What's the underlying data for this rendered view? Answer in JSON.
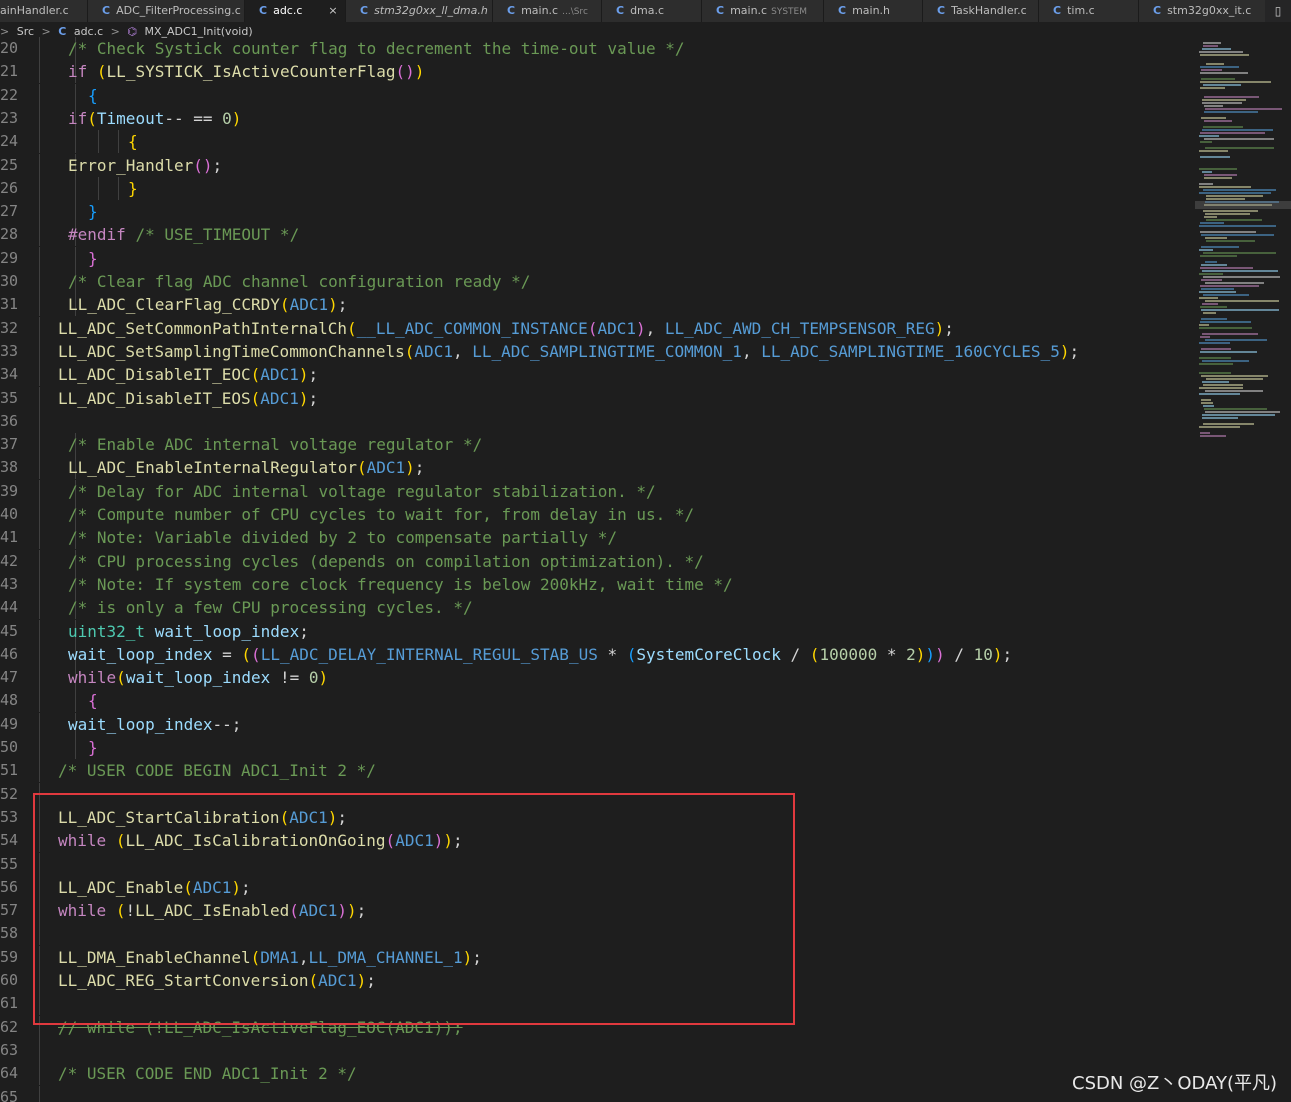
{
  "tabs": [
    {
      "label": "ainHandler.c",
      "italic": false,
      "hint": "",
      "active": false,
      "icon": false
    },
    {
      "label": "ADC_FilterProcessing.c",
      "italic": false,
      "hint": "",
      "active": false,
      "icon": true
    },
    {
      "label": "adc.c",
      "italic": false,
      "hint": "",
      "active": true,
      "icon": true,
      "close": "×"
    },
    {
      "label": "stm32g0xx_ll_dma.h",
      "italic": true,
      "hint": "",
      "active": false,
      "icon": true
    },
    {
      "label": "main.c",
      "italic": false,
      "hint": "...\\Src",
      "active": false,
      "icon": true
    },
    {
      "label": "dma.c",
      "italic": false,
      "hint": "",
      "active": false,
      "icon": true
    },
    {
      "label": "main.c",
      "italic": false,
      "hint": "SYSTEM",
      "active": false,
      "icon": true
    },
    {
      "label": "main.h",
      "italic": false,
      "hint": "",
      "active": false,
      "icon": true
    },
    {
      "label": "TaskHandler.c",
      "italic": false,
      "hint": "",
      "active": false,
      "icon": true
    },
    {
      "label": "tim.c",
      "italic": false,
      "hint": "",
      "active": false,
      "icon": true
    },
    {
      "label": "stm32g0xx_it.c",
      "italic": false,
      "hint": "",
      "active": false,
      "icon": true
    }
  ],
  "tab_icon_glyph": "C",
  "split_icon": "▯",
  "breadcrumb": {
    "sep": ">",
    "folder": "Src",
    "file_icon": "C",
    "file": "adc.c",
    "fn_icon": "⌬",
    "function": "MX_ADC1_Init(void)"
  },
  "lines": [
    {
      "n": "20",
      "indent": 1,
      "tokens": [
        [
          "cm",
          "/* Check Systick counter flag to decrement the time-out value */"
        ]
      ]
    },
    {
      "n": "21",
      "indent": 1,
      "tokens": [
        [
          "kw",
          "if"
        ],
        [
          "pun",
          " "
        ],
        [
          "b1",
          "("
        ],
        [
          "fn",
          "LL_SYSTICK_IsActiveCounterFlag"
        ],
        [
          "b2",
          "()"
        ],
        [
          "b1",
          ")"
        ]
      ]
    },
    {
      "n": "22",
      "indent": 2,
      "tokens": [
        [
          "b3",
          "{"
        ]
      ]
    },
    {
      "n": "23",
      "indent": 1,
      "tokens": [
        [
          "kw",
          "if"
        ],
        [
          "b1",
          "("
        ],
        [
          "var",
          "Timeout"
        ],
        [
          "pun",
          "-- == "
        ],
        [
          "num",
          "0"
        ],
        [
          "b1",
          ")"
        ]
      ]
    },
    {
      "n": "24",
      "indent": 4,
      "tokens": [
        [
          "b1",
          "{"
        ]
      ]
    },
    {
      "n": "25",
      "indent": 1,
      "tokens": [
        [
          "fn",
          "Error_Handler"
        ],
        [
          "b2",
          "()"
        ],
        [
          "pun",
          ";"
        ]
      ]
    },
    {
      "n": "26",
      "indent": 4,
      "tokens": [
        [
          "b1",
          "}"
        ]
      ]
    },
    {
      "n": "27",
      "indent": 2,
      "tokens": [
        [
          "b3",
          "}"
        ]
      ]
    },
    {
      "n": "28",
      "indent": 1,
      "tokens": [
        [
          "pp",
          "#endif"
        ],
        [
          "pun",
          " "
        ],
        [
          "cm",
          "/* USE_TIMEOUT */"
        ]
      ]
    },
    {
      "n": "29",
      "indent": 2,
      "tokens": [
        [
          "b2",
          "}"
        ]
      ]
    },
    {
      "n": "30",
      "indent": 1,
      "tokens": [
        [
          "cm",
          "/* Clear flag ADC channel configuration ready */"
        ]
      ]
    },
    {
      "n": "31",
      "indent": 1,
      "tokens": [
        [
          "fn",
          "LL_ADC_ClearFlag_CCRDY"
        ],
        [
          "b1",
          "("
        ],
        [
          "mac",
          "ADC1"
        ],
        [
          "b1",
          ")"
        ],
        [
          "pun",
          ";"
        ]
      ]
    },
    {
      "n": "32",
      "indent": 0,
      "tokens": [
        [
          "fn",
          "LL_ADC_SetCommonPathInternalCh"
        ],
        [
          "b1",
          "("
        ],
        [
          "mac",
          "__LL_ADC_COMMON_INSTANCE"
        ],
        [
          "b2",
          "("
        ],
        [
          "mac",
          "ADC1"
        ],
        [
          "b2",
          ")"
        ],
        [
          "pun",
          ", "
        ],
        [
          "mac",
          "LL_ADC_AWD_CH_TEMPSENSOR_REG"
        ],
        [
          "b1",
          ")"
        ],
        [
          "pun",
          ";"
        ]
      ]
    },
    {
      "n": "33",
      "indent": 0,
      "tokens": [
        [
          "fn",
          "LL_ADC_SetSamplingTimeCommonChannels"
        ],
        [
          "b1",
          "("
        ],
        [
          "mac",
          "ADC1"
        ],
        [
          "pun",
          ", "
        ],
        [
          "mac",
          "LL_ADC_SAMPLINGTIME_COMMON_1"
        ],
        [
          "pun",
          ", "
        ],
        [
          "mac",
          "LL_ADC_SAMPLINGTIME_160CYCLES_5"
        ],
        [
          "b1",
          ")"
        ],
        [
          "pun",
          ";"
        ]
      ]
    },
    {
      "n": "34",
      "indent": 0,
      "tokens": [
        [
          "fn",
          "LL_ADC_DisableIT_EOC"
        ],
        [
          "b1",
          "("
        ],
        [
          "mac",
          "ADC1"
        ],
        [
          "b1",
          ")"
        ],
        [
          "pun",
          ";"
        ]
      ]
    },
    {
      "n": "35",
      "indent": 0,
      "tokens": [
        [
          "fn",
          "LL_ADC_DisableIT_EOS"
        ],
        [
          "b1",
          "("
        ],
        [
          "mac",
          "ADC1"
        ],
        [
          "b1",
          ")"
        ],
        [
          "pun",
          ";"
        ]
      ]
    },
    {
      "n": "36",
      "indent": 0,
      "tokens": []
    },
    {
      "n": "37",
      "indent": 1,
      "tokens": [
        [
          "cm",
          "/* Enable ADC internal voltage regulator */"
        ]
      ]
    },
    {
      "n": "38",
      "indent": 1,
      "tokens": [
        [
          "fn",
          "LL_ADC_EnableInternalRegulator"
        ],
        [
          "b1",
          "("
        ],
        [
          "mac",
          "ADC1"
        ],
        [
          "b1",
          ")"
        ],
        [
          "pun",
          ";"
        ]
      ]
    },
    {
      "n": "39",
      "indent": 1,
      "tokens": [
        [
          "cm",
          "/* Delay for ADC internal voltage regulator stabilization. */"
        ]
      ]
    },
    {
      "n": "40",
      "indent": 1,
      "tokens": [
        [
          "cm",
          "/* Compute number of CPU cycles to wait for, from delay in us. */"
        ]
      ]
    },
    {
      "n": "41",
      "indent": 1,
      "tokens": [
        [
          "cm",
          "/* Note: Variable divided by 2 to compensate partially */"
        ]
      ]
    },
    {
      "n": "42",
      "indent": 1,
      "tokens": [
        [
          "cm",
          "/* CPU processing cycles (depends on compilation optimization). */"
        ]
      ]
    },
    {
      "n": "43",
      "indent": 1,
      "tokens": [
        [
          "cm",
          "/* Note: If system core clock frequency is below 200kHz, wait time */"
        ]
      ]
    },
    {
      "n": "44",
      "indent": 1,
      "tokens": [
        [
          "cm",
          "/* is only a few CPU processing cycles. */"
        ]
      ]
    },
    {
      "n": "45",
      "indent": 1,
      "tokens": [
        [
          "ty",
          "uint32_t"
        ],
        [
          "pun",
          " "
        ],
        [
          "var",
          "wait_loop_index"
        ],
        [
          "pun",
          ";"
        ]
      ]
    },
    {
      "n": "46",
      "indent": 1,
      "tokens": [
        [
          "var",
          "wait_loop_index"
        ],
        [
          "pun",
          " = "
        ],
        [
          "b1",
          "("
        ],
        [
          "b2",
          "("
        ],
        [
          "mac",
          "LL_ADC_DELAY_INTERNAL_REGUL_STAB_US"
        ],
        [
          "pun",
          " * "
        ],
        [
          "b3",
          "("
        ],
        [
          "var",
          "SystemCoreClock"
        ],
        [
          "pun",
          " / "
        ],
        [
          "b1",
          "("
        ],
        [
          "num",
          "100000"
        ],
        [
          "pun",
          " * "
        ],
        [
          "num",
          "2"
        ],
        [
          "b1",
          ")"
        ],
        [
          "b3",
          ")"
        ],
        [
          "b2",
          ")"
        ],
        [
          "pun",
          " / "
        ],
        [
          "num",
          "10"
        ],
        [
          "b1",
          ")"
        ],
        [
          "pun",
          ";"
        ]
      ]
    },
    {
      "n": "47",
      "indent": 1,
      "tokens": [
        [
          "kw",
          "while"
        ],
        [
          "b1",
          "("
        ],
        [
          "var",
          "wait_loop_index"
        ],
        [
          "pun",
          " != "
        ],
        [
          "num",
          "0"
        ],
        [
          "b1",
          ")"
        ]
      ]
    },
    {
      "n": "48",
      "indent": 2,
      "tokens": [
        [
          "b2",
          "{"
        ]
      ]
    },
    {
      "n": "49",
      "indent": 1,
      "tokens": [
        [
          "var",
          "wait_loop_index"
        ],
        [
          "pun",
          "--;"
        ]
      ]
    },
    {
      "n": "50",
      "indent": 2,
      "tokens": [
        [
          "b2",
          "}"
        ]
      ]
    },
    {
      "n": "51",
      "indent": 0,
      "tokens": [
        [
          "cm",
          "/* USER CODE BEGIN ADC1_Init 2 */"
        ]
      ]
    },
    {
      "n": "52",
      "indent": 0,
      "tokens": []
    },
    {
      "n": "53",
      "indent": 0,
      "tokens": [
        [
          "fn",
          "LL_ADC_StartCalibration"
        ],
        [
          "b1",
          "("
        ],
        [
          "mac",
          "ADC1"
        ],
        [
          "b1",
          ")"
        ],
        [
          "pun",
          ";"
        ]
      ]
    },
    {
      "n": "54",
      "indent": 0,
      "tokens": [
        [
          "kw",
          "while"
        ],
        [
          "pun",
          " "
        ],
        [
          "b1",
          "("
        ],
        [
          "fn",
          "LL_ADC_IsCalibrationOnGoing"
        ],
        [
          "b2",
          "("
        ],
        [
          "mac",
          "ADC1"
        ],
        [
          "b2",
          ")"
        ],
        [
          "b1",
          ")"
        ],
        [
          "pun",
          ";"
        ]
      ]
    },
    {
      "n": "55",
      "indent": 0,
      "tokens": []
    },
    {
      "n": "56",
      "indent": 0,
      "tokens": [
        [
          "fn",
          "LL_ADC_Enable"
        ],
        [
          "b1",
          "("
        ],
        [
          "mac",
          "ADC1"
        ],
        [
          "b1",
          ")"
        ],
        [
          "pun",
          ";"
        ]
      ]
    },
    {
      "n": "57",
      "indent": 0,
      "tokens": [
        [
          "kw",
          "while"
        ],
        [
          "pun",
          " "
        ],
        [
          "b1",
          "("
        ],
        [
          "pun",
          "!"
        ],
        [
          "fn",
          "LL_ADC_IsEnabled"
        ],
        [
          "b2",
          "("
        ],
        [
          "mac",
          "ADC1"
        ],
        [
          "b2",
          ")"
        ],
        [
          "b1",
          ")"
        ],
        [
          "pun",
          ";"
        ]
      ]
    },
    {
      "n": "58",
      "indent": 0,
      "tokens": []
    },
    {
      "n": "59",
      "indent": 0,
      "tokens": [
        [
          "fn",
          "LL_DMA_EnableChannel"
        ],
        [
          "b1",
          "("
        ],
        [
          "mac",
          "DMA1"
        ],
        [
          "pun",
          ","
        ],
        [
          "mac",
          "LL_DMA_CHANNEL_1"
        ],
        [
          "b1",
          ")"
        ],
        [
          "pun",
          ";"
        ]
      ]
    },
    {
      "n": "60",
      "indent": 0,
      "tokens": [
        [
          "fn",
          "LL_ADC_REG_StartConversion"
        ],
        [
          "b1",
          "("
        ],
        [
          "mac",
          "ADC1"
        ],
        [
          "b1",
          ")"
        ],
        [
          "pun",
          ";"
        ]
      ]
    },
    {
      "n": "61",
      "indent": 0,
      "tokens": []
    },
    {
      "n": "62",
      "indent": 0,
      "tokens": [
        [
          "strike",
          "// while (!LL_ADC_IsActiveFlag_EOC(ADC1));"
        ]
      ]
    },
    {
      "n": "63",
      "indent": 0,
      "tokens": []
    },
    {
      "n": "64",
      "indent": 0,
      "tokens": [
        [
          "cm",
          "/* USER CODE END ADC1_Init 2 */"
        ]
      ]
    },
    {
      "n": "65",
      "indent": 0,
      "tokens": []
    }
  ],
  "watermark": "CSDN @Z丶ODAY(平凡)",
  "colors": {
    "background": "#1e1e1e",
    "highlight_box": "#e0393e",
    "comment": "#6a9955",
    "function": "#dcdcaa",
    "macro": "#569cd6"
  }
}
